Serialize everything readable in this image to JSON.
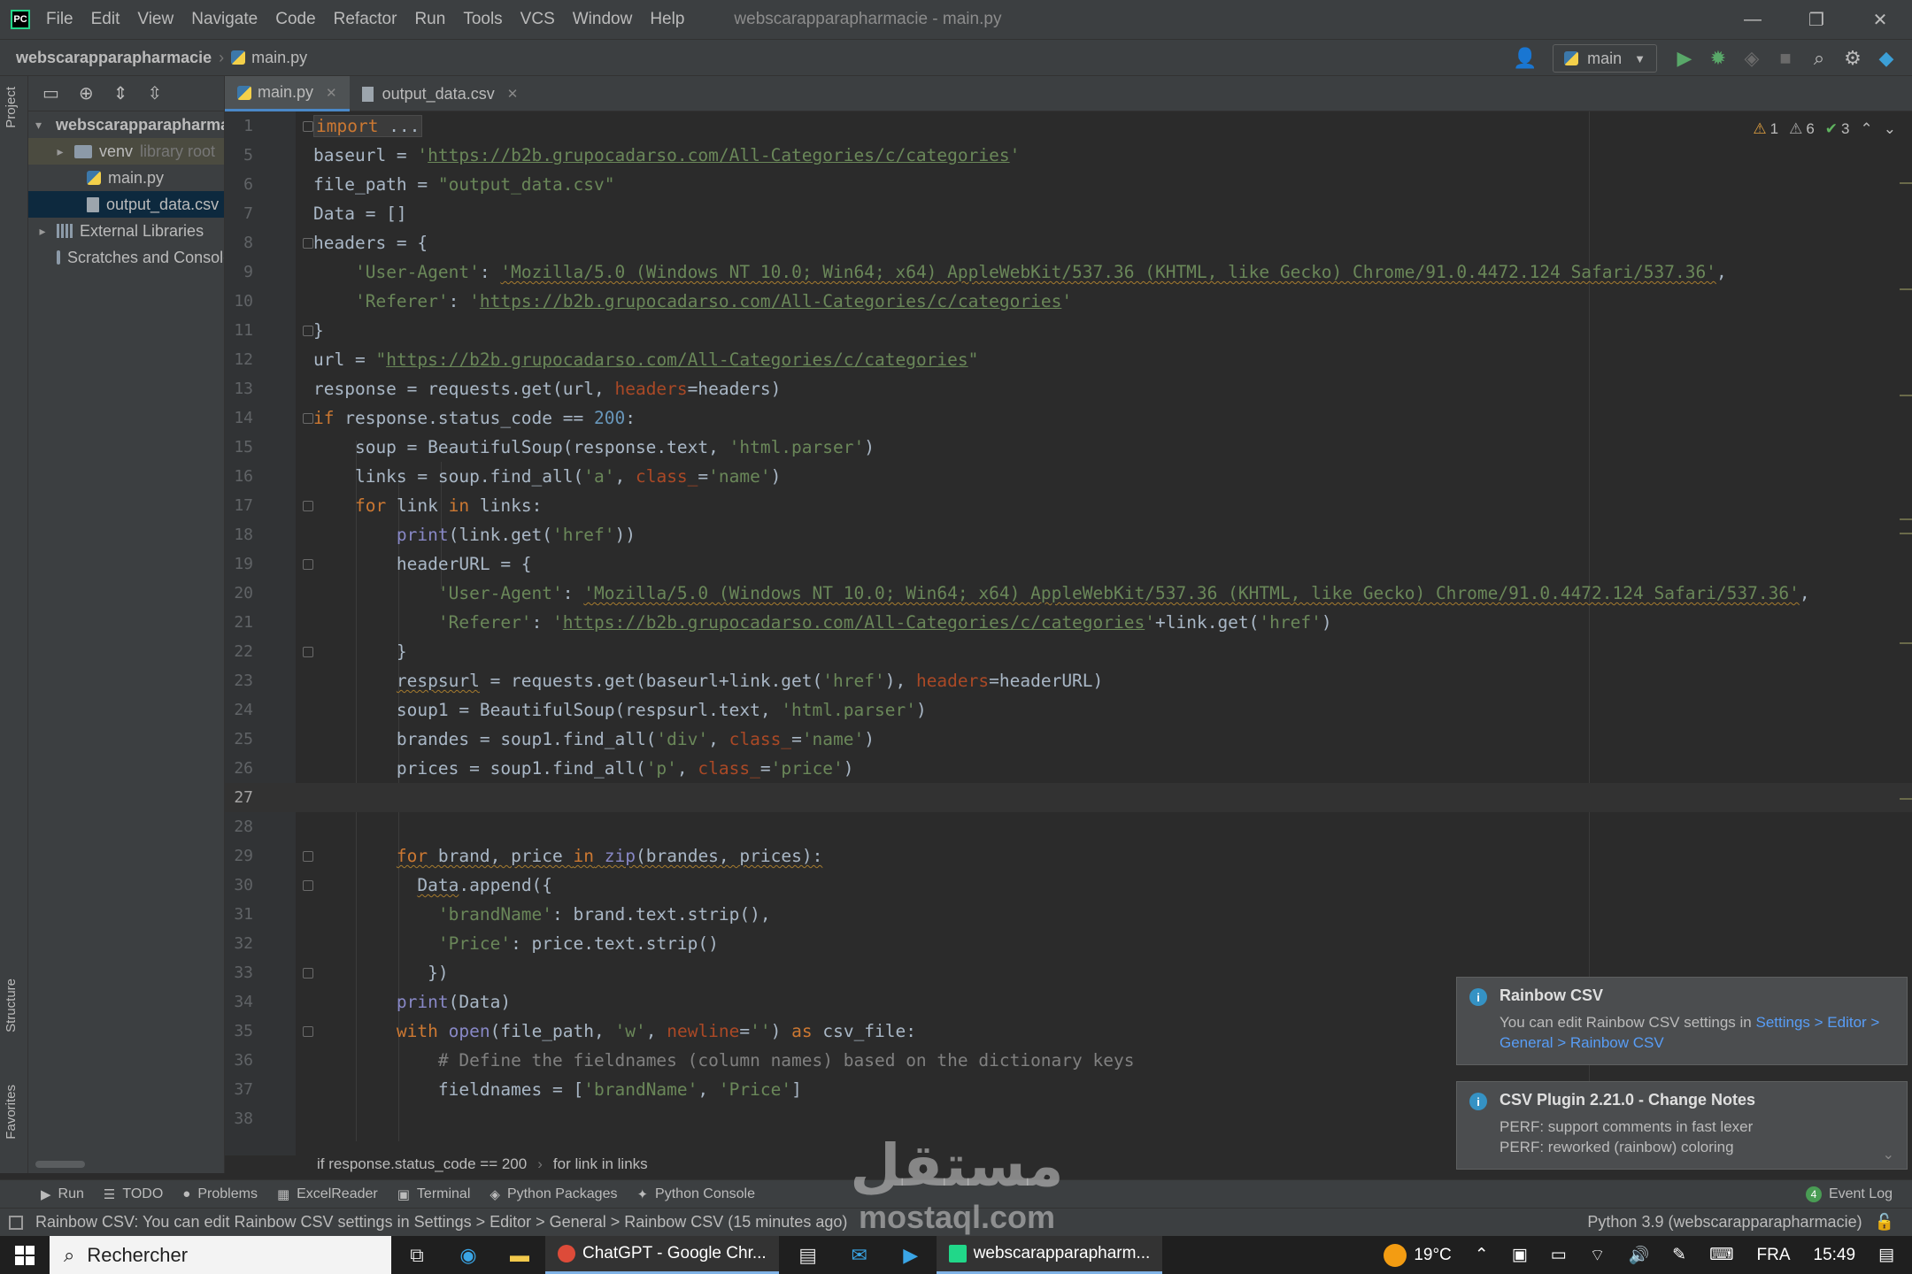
{
  "app": {
    "logo": "PC",
    "window_title": "webscarapparapharmacie - main.py",
    "menu": [
      "File",
      "Edit",
      "View",
      "Navigate",
      "Code",
      "Refactor",
      "Run",
      "Tools",
      "VCS",
      "Window",
      "Help"
    ],
    "controls": {
      "minimize": "—",
      "restore": "❐",
      "close": "✕"
    }
  },
  "navbar": {
    "project": "webscarapparapharmacie",
    "file": "main.py",
    "run_config": "main",
    "icons": [
      "user-icon",
      "run-icon",
      "debug-icon",
      "coverage-icon",
      "stop-icon",
      "search-icon",
      "gear-icon",
      "toolbox-icon"
    ]
  },
  "left_stripe": {
    "project_tab": "Project",
    "structure_tab": "Structure",
    "favorites_tab": "Favorites"
  },
  "project_tree": [
    {
      "label": "webscarapparapharmacie",
      "kind": "folder",
      "arrow": "▾",
      "indent": 0,
      "bold": true
    },
    {
      "label": "venv",
      "kind": "folder",
      "arrow": "▸",
      "indent": 1,
      "suffix": "library root"
    },
    {
      "label": "main.py",
      "kind": "py",
      "indent": 2
    },
    {
      "label": "output_data.csv",
      "kind": "csv",
      "indent": 2
    },
    {
      "label": "External Libraries",
      "kind": "lib",
      "arrow": "▸",
      "indent": 0
    },
    {
      "label": "Scratches and Consoles",
      "kind": "scratch",
      "indent": 1
    }
  ],
  "tabs": [
    {
      "label": "main.py",
      "active": true
    },
    {
      "label": "output_data.csv",
      "active": false
    }
  ],
  "inspection": {
    "errors": "1",
    "warnings": "6",
    "weak": "3"
  },
  "code_lines": [
    {
      "n": "1",
      "html": "<span class=\"fold-block\"><span class=\"kw\">import</span> ...</span>",
      "fold": true
    },
    {
      "n": "5",
      "html": "baseurl = <span class=\"str\">'<span class=\"url\">https://b2b.grupocadarso.com/All-Categories/c/categories</span>'</span>"
    },
    {
      "n": "6",
      "html": "file_path = <span class=\"str\">\"output_data.csv\"</span>"
    },
    {
      "n": "7",
      "html": "Data = []"
    },
    {
      "n": "8",
      "html": "headers = {",
      "fold": true
    },
    {
      "n": "9",
      "html": "    <span class=\"str\">'User-Agent'</span>: <span class=\"str squig\">'Mozilla/5.0 (Windows NT 10.0; Win64; x64) AppleWebKit/537.36 (KHTML, like Gecko) Chrome/91.0.4472.124 Safari/537.36'</span>,"
    },
    {
      "n": "10",
      "html": "    <span class=\"str\">'Referer'</span>: <span class=\"str\">'<span class=\"url\">https://b2b.grupocadarso.com/All-Categories/c/categories</span>'</span>"
    },
    {
      "n": "11",
      "html": "}",
      "fold": true
    },
    {
      "n": "12",
      "html": "url = <span class=\"str\">\"<span class=\"url\">https://b2b.grupocadarso.com/All-Categories/c/categories</span>\"</span>"
    },
    {
      "n": "13",
      "html": "response = requests.get(url, <span class=\"param\">headers</span>=headers)"
    },
    {
      "n": "14",
      "html": "<span class=\"kw\">if</span> response.status_code == <span class=\"num\">200</span>:",
      "fold": true
    },
    {
      "n": "15",
      "html": "    soup = BeautifulSoup(response.text, <span class=\"str\">'html.parser'</span>)"
    },
    {
      "n": "16",
      "html": "    links = soup.find_all(<span class=\"str\">'a'</span>, <span class=\"param\">class_</span>=<span class=\"str\">'name'</span>)"
    },
    {
      "n": "17",
      "html": "    <span class=\"kw\">for</span> link <span class=\"kw\">in</span> links:",
      "fold": true
    },
    {
      "n": "18",
      "html": "        <span class=\"bi\">print</span>(link.get(<span class=\"str\">'href'</span>))"
    },
    {
      "n": "19",
      "html": "        headerURL = {",
      "fold": true
    },
    {
      "n": "20",
      "html": "            <span class=\"str\">'User-Agent'</span>: <span class=\"str squig\">'Mozilla/5.0 (Windows NT 10.0; Win64; x64) AppleWebKit/537.36 (KHTML, like Gecko) Chrome/91.0.4472.124 Safari/537.36'</span>,"
    },
    {
      "n": "21",
      "html": "            <span class=\"str\">'Referer'</span>: <span class=\"str\">'<span class=\"url\">https://b2b.grupocadarso.com/All-Categories/c/categories</span>'</span>+link.get(<span class=\"str\">'href'</span>)"
    },
    {
      "n": "22",
      "html": "        }",
      "fold": true
    },
    {
      "n": "23",
      "html": "        <span class=\"squig\">respsurl</span> = requests.get(baseurl+link.get(<span class=\"str\">'href'</span>), <span class=\"param\">headers</span>=headerURL)"
    },
    {
      "n": "24",
      "html": "        soup1 = BeautifulSoup(respsurl.text, <span class=\"str\">'html.parser'</span>)"
    },
    {
      "n": "25",
      "html": "        brandes = soup1.find_all(<span class=\"str\">'div'</span>, <span class=\"param\">class_</span>=<span class=\"str\">'name'</span>)"
    },
    {
      "n": "26",
      "html": "        prices = soup1.find_all(<span class=\"str\">'p'</span>, <span class=\"param\">class_</span>=<span class=\"str\">'price'</span>)"
    },
    {
      "n": "27",
      "html": "",
      "current": true
    },
    {
      "n": "28",
      "html": ""
    },
    {
      "n": "29",
      "html": "        <span class=\"squig\"><span class=\"kw\">for</span> brand, price <span class=\"kw\">in</span> <span class=\"bi\">zip</span>(brandes, prices):</span>",
      "fold": true
    },
    {
      "n": "30",
      "html": "          <span class=\"squig\">Data</span>.append({",
      "fold": true
    },
    {
      "n": "31",
      "html": "            <span class=\"str\">'brandName'</span>: brand.text.strip(),"
    },
    {
      "n": "32",
      "html": "            <span class=\"str\">'Price'</span>: price.text.strip()"
    },
    {
      "n": "33",
      "html": "           })",
      "fold": true
    },
    {
      "n": "34",
      "html": "        <span class=\"bi\">print</span>(Data)"
    },
    {
      "n": "35",
      "html": "        <span class=\"kw\">with</span> <span class=\"bi\">open</span>(file_path, <span class=\"str\">'w'</span>, <span class=\"param\">newline</span>=<span class=\"str\">''</span>) <span class=\"kw\">as</span> csv_file:",
      "fold": true
    },
    {
      "n": "36",
      "html": "            <span class=\"cmt\"># Define the fieldnames (column names) based on the dictionary keys</span>"
    },
    {
      "n": "37",
      "html": "            fieldnames = [<span class=\"str\">'brandName'</span>, <span class=\"str\">'Price'</span>]"
    },
    {
      "n": "38",
      "html": ""
    }
  ],
  "editor_breadcrumb": [
    "if response.status_code == 200",
    "for link in links"
  ],
  "notifications": [
    {
      "title": "Rainbow CSV",
      "text": "You can edit Rainbow CSV settings in ",
      "link": "Settings > Editor > General > Rainbow CSV"
    },
    {
      "title": "CSV Plugin 2.21.0 - Change Notes",
      "text": "PERF: support comments in fast lexer",
      "text2": "PERF: reworked (rainbow) coloring"
    }
  ],
  "tool_windows": [
    "Run",
    "TODO",
    "Problems",
    "ExcelReader",
    "Terminal",
    "Python Packages",
    "Python Console"
  ],
  "event_log": {
    "count": "4",
    "label": "Event Log"
  },
  "status": {
    "message": "Rainbow CSV: You can edit Rainbow CSV settings in Settings > Editor > General > Rainbow CSV (15 minutes ago)",
    "interpreter": "Python 3.9 (webscarapparapharmacie)"
  },
  "watermark": {
    "arabic": "مستقل",
    "latin": "mostaql.com"
  },
  "taskbar": {
    "search_placeholder": "Rechercher",
    "apps": [
      {
        "label": "ChatGPT - Google Chr...",
        "color": "#dd4b39"
      },
      {
        "label": "webscarapparapharm...",
        "color": "#21d789"
      }
    ],
    "weather": "19°C",
    "language": "FRA",
    "time": "15:49"
  }
}
